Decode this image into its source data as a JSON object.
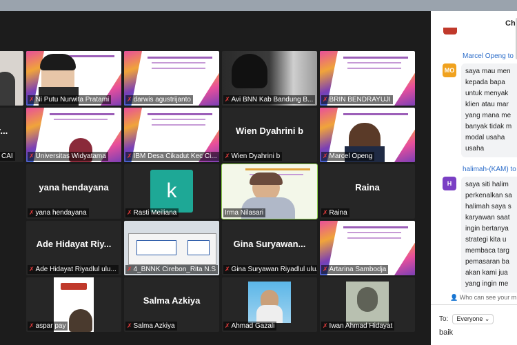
{
  "participants": [
    {
      "name": "Ni Putu Nurwita Pratami",
      "big": "",
      "kind": "person-slide"
    },
    {
      "name": "darwis agustrijanto",
      "big": "",
      "kind": "slide"
    },
    {
      "name": "Avi BNN Kab Bandung B...",
      "big": "",
      "kind": "dark-video"
    },
    {
      "name": "BRIN BENDRAYUJI",
      "big": "",
      "kind": "slide"
    },
    {
      "name": "Universitas Widyatama",
      "big": "",
      "kind": "person-slide"
    },
    {
      "name": "IBM Desa Cikadut Kec Ci...",
      "big": "",
      "kind": "slide"
    },
    {
      "name": "Wien Dyahrini b",
      "big": "Wien Dyahrini b",
      "kind": "name"
    },
    {
      "name": "Marcel Openg",
      "big": "",
      "kind": "person-slide"
    },
    {
      "name": "yana hendayana",
      "big": "yana hendayana",
      "kind": "name"
    },
    {
      "name": "Rasti Meiliana",
      "big": "k",
      "kind": "avatar"
    },
    {
      "name": "Irma Nilasari",
      "big": "",
      "kind": "speaker"
    },
    {
      "name": "Raina",
      "big": "Raina",
      "kind": "name"
    },
    {
      "name": "Ade Hidayat Riyadlul ulu...",
      "big": "Ade Hidayat Riy...",
      "kind": "name"
    },
    {
      "name": "4_BNNK Cirebon_Rita N.S",
      "big": "",
      "kind": "building"
    },
    {
      "name": "Gina Suryawan Riyadlul ulu...",
      "big": "Gina Suryawan...",
      "kind": "name"
    },
    {
      "name": "Artarina Sambodja",
      "big": "",
      "kind": "slide"
    },
    {
      "name": "aspar pay",
      "big": "",
      "kind": "person-slide"
    },
    {
      "name": "Salma Azkiya",
      "big": "Salma Azkiya",
      "kind": "name"
    },
    {
      "name": "Ahmad Gazali",
      "big": "",
      "kind": "photo"
    },
    {
      "name": "Iwan Ahmad Hidayat",
      "big": "",
      "kind": "photo"
    }
  ],
  "left_column": [
    {
      "name": "",
      "big": ""
    },
    {
      "name": "CAI",
      "big": "r..."
    }
  ],
  "chat": {
    "title": "Ch",
    "messages": [
      {
        "sender": "Marcel Openg to",
        "initials": "MO",
        "color": "#f0a21f",
        "lines": [
          "saya mau men",
          "kepada bapa",
          "untuk menyak",
          "klien atau mar",
          "yang mana me",
          "banyak tidak m",
          "modal usaha",
          "usaha"
        ]
      },
      {
        "sender": "halimah-(KAM) to",
        "initials": "H",
        "color": "#7a3fc4",
        "lines": [
          "saya siti halim",
          "perkenalkan sa",
          "halimah saya s",
          "karyawan saat",
          "ingin bertanya",
          "strategi kita u",
          "membaca targ",
          "pemasaran ba",
          "akan kami jua",
          "yang ingin me"
        ]
      }
    ],
    "who_can_see": "Who can see your m",
    "to_label": "To:",
    "to_value": "Everyone",
    "input_value": "baik"
  }
}
